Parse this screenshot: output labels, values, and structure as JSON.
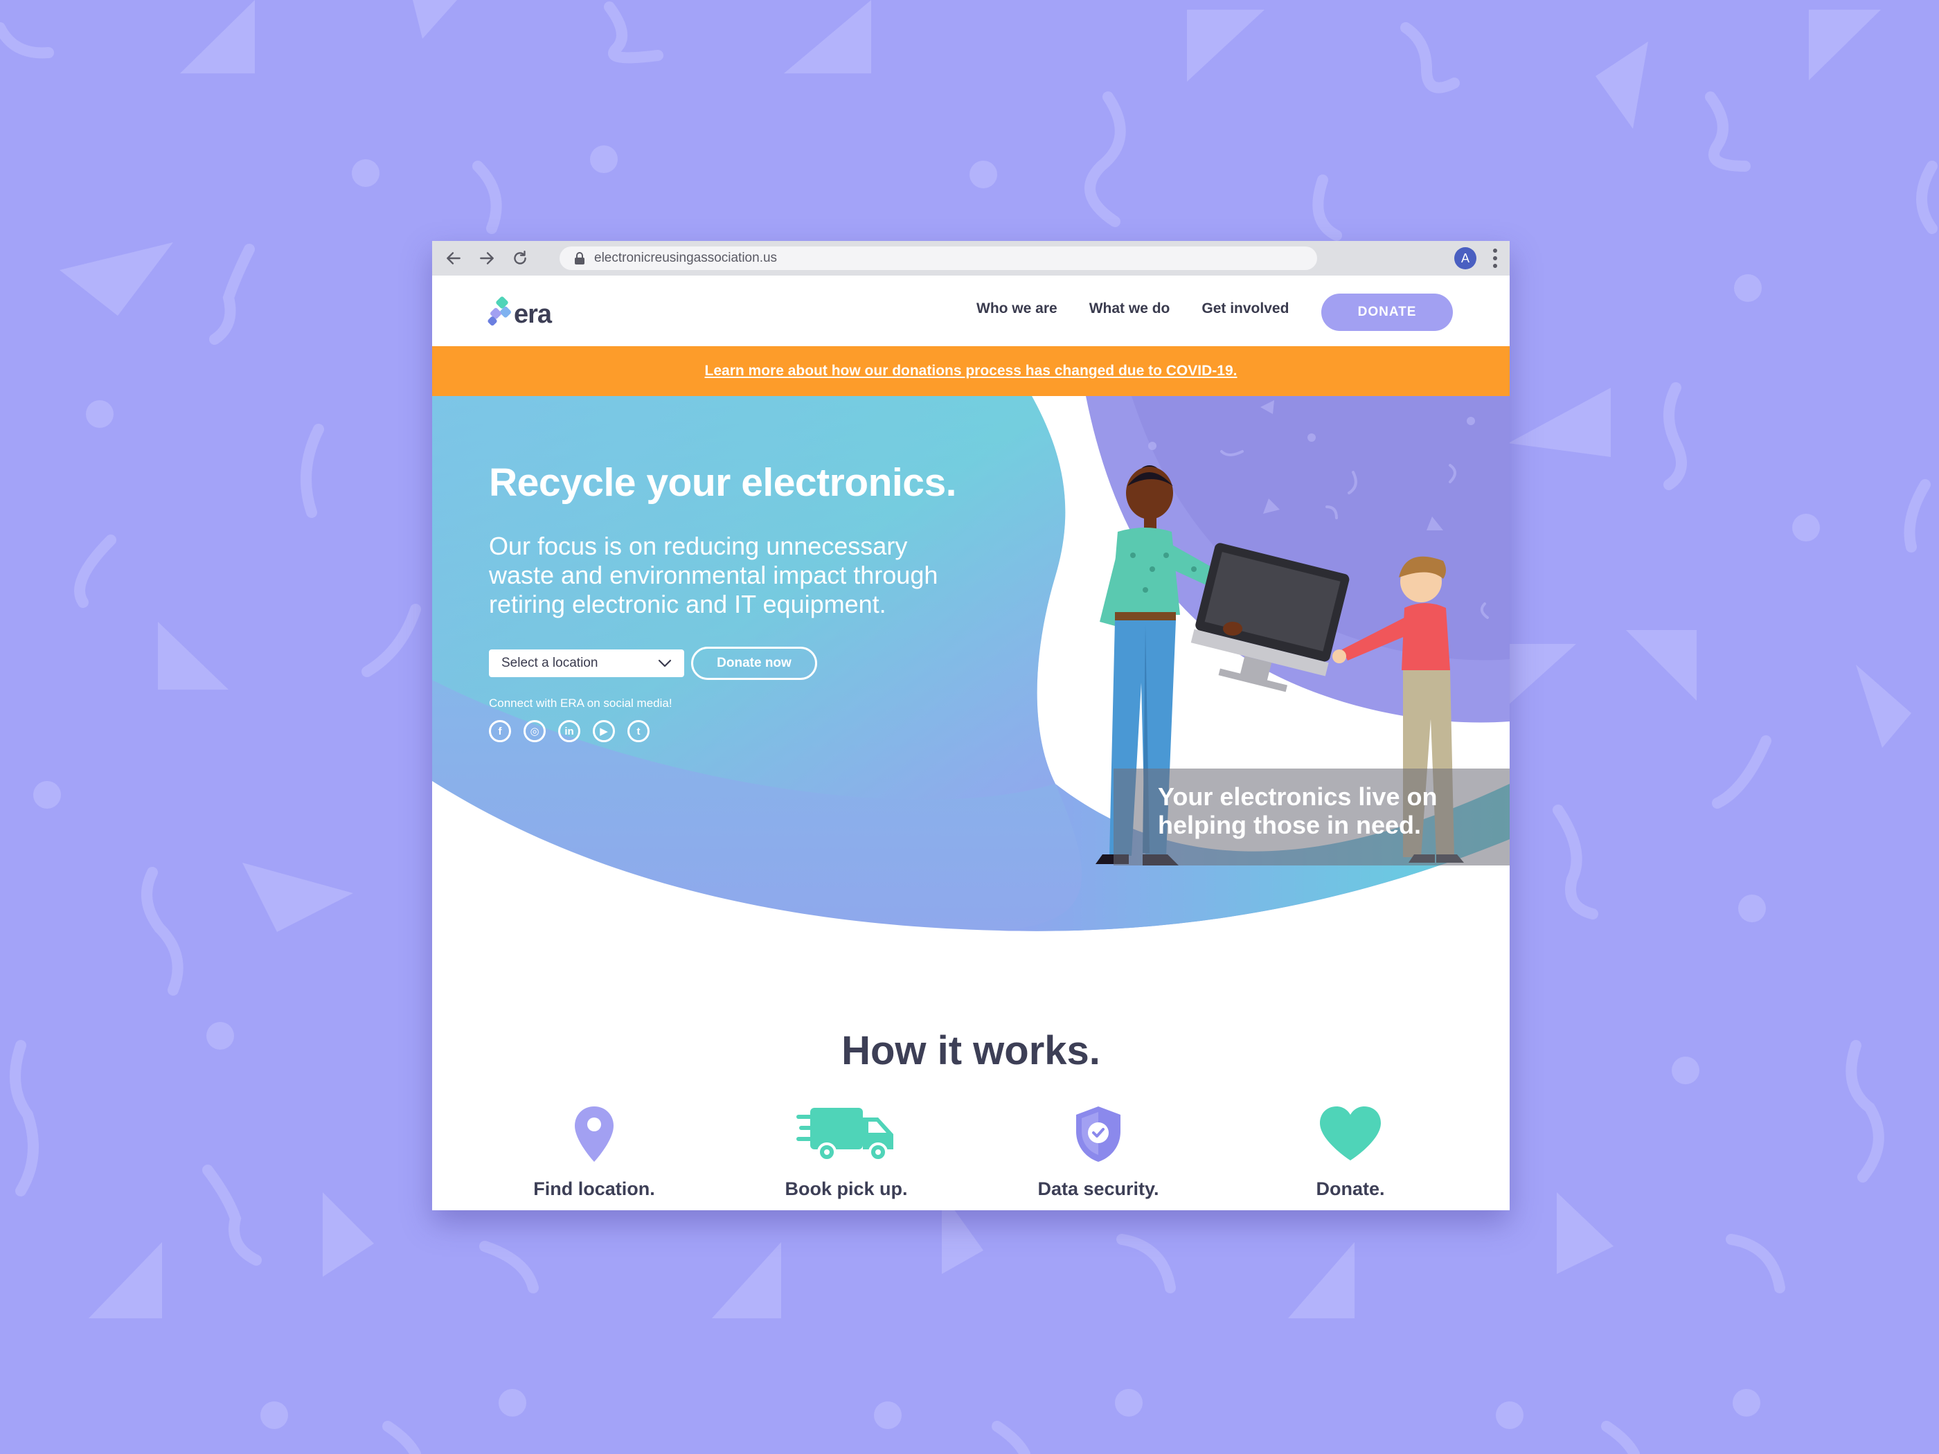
{
  "browser": {
    "url": "electronicreusingassociation.us",
    "profile_initial": "A"
  },
  "header": {
    "logo_text": "era",
    "nav": [
      "Who we are",
      "What we do",
      "Get involved"
    ],
    "donate_label": "DONATE"
  },
  "banner": {
    "text": "Learn more about how our donations process has changed due to COVID-19."
  },
  "hero": {
    "title": "Recycle your electronics.",
    "subtitle": "Our focus is on reducing unnecessary waste and environmental impact through retiring electronic and IT equipment.",
    "location_placeholder": "Select a location",
    "donate_now_label": "Donate now",
    "social_label": "Connect with ERA on social media!",
    "social": [
      {
        "name": "facebook-icon",
        "glyph": "f"
      },
      {
        "name": "instagram-icon",
        "glyph": "◎"
      },
      {
        "name": "linkedin-icon",
        "glyph": "in"
      },
      {
        "name": "youtube-icon",
        "glyph": "▶"
      },
      {
        "name": "twitter-icon",
        "glyph": "t"
      }
    ],
    "caption_line1": "Your electronics live on",
    "caption_line2": "helping those in need."
  },
  "how_it_works": {
    "title": "How it works.",
    "steps": [
      {
        "icon": "location-pin-icon",
        "label": "Find location."
      },
      {
        "icon": "truck-icon",
        "label": "Book pick up."
      },
      {
        "icon": "shield-check-icon",
        "label": "Data security."
      },
      {
        "icon": "heart-icon",
        "label": "Donate."
      }
    ]
  },
  "colors": {
    "background": "#a3a3f8",
    "accent_purple": "#a2a0f2",
    "banner_orange": "#fd9c2a",
    "teal": "#4fd4b8",
    "text_dark": "#3d3f56"
  }
}
